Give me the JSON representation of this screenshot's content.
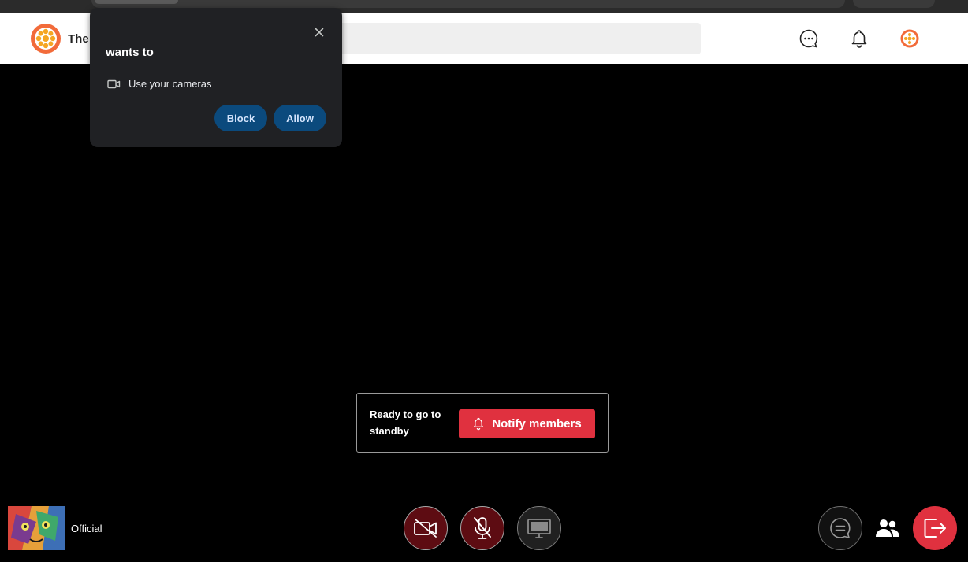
{
  "header": {
    "app_name": "The"
  },
  "permission_prompt": {
    "title": "wants to",
    "permission": "Use your cameras",
    "block_label": "Block",
    "allow_label": "Allow"
  },
  "standby": {
    "message": "Ready to go to standby",
    "notify_label": "Notify members"
  },
  "self_view": {
    "name": "Official"
  },
  "colors": {
    "brand_orange": "#f26b3a",
    "danger_red": "#e0313f",
    "muted_red": "#5d0c12"
  }
}
